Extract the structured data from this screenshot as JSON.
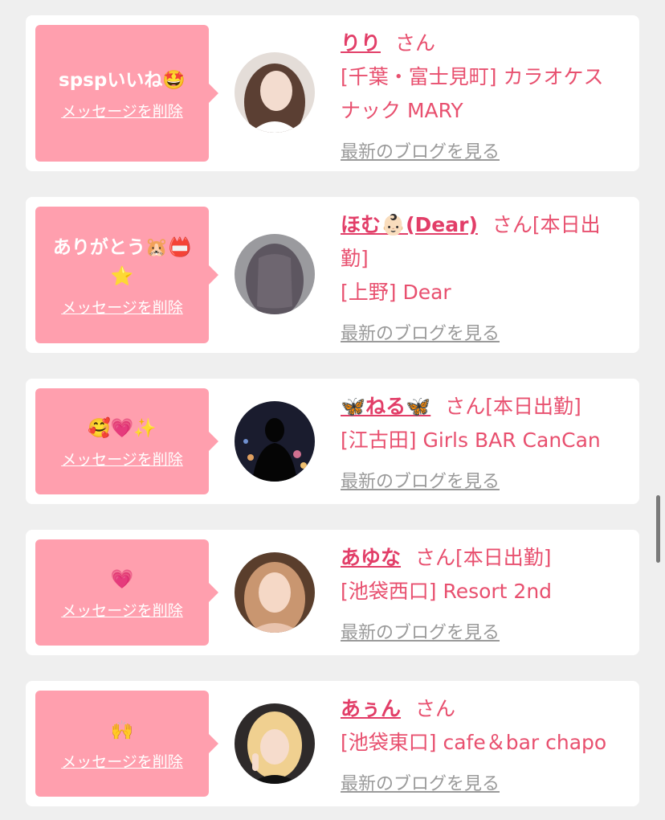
{
  "messages": [
    {
      "message": "spspいいね🤩",
      "delete_label": "メッセージを削除",
      "name": "りり",
      "suffix": "さん",
      "shop": "[千葉・富士見町] カラオケスナック MARY",
      "blog_label": "最新のブログを見る"
    },
    {
      "message": "ありがとう🐹📛⭐",
      "delete_label": "メッセージを削除",
      "name": "ほむ👶🏻(Dear)",
      "suffix": "さん[本日出勤]",
      "shop": "[上野] Dear",
      "blog_label": "最新のブログを見る"
    },
    {
      "message": "🥰💗✨",
      "delete_label": "メッセージを削除",
      "name": "🦋ねる🦋",
      "suffix": "さん[本日出勤]",
      "shop": "[江古田] Girls BAR CanCan",
      "blog_label": "最新のブログを見る"
    },
    {
      "message": "💗",
      "delete_label": "メッセージを削除",
      "name": "あゆな",
      "suffix": "さん[本日出勤]",
      "shop": "[池袋西口] Resort 2nd",
      "blog_label": "最新のブログを見る"
    },
    {
      "message": "🙌",
      "delete_label": "メッセージを削除",
      "name": "あぅん",
      "suffix": "さん",
      "shop": "[池袋東口] cafe＆bar chapo",
      "blog_label": "最新のブログを見る"
    }
  ],
  "colors": {
    "page_bg": "#efefef",
    "bubble": "#ff9fae",
    "accent": "#e8506f",
    "link_gray": "#9a9a9a"
  }
}
